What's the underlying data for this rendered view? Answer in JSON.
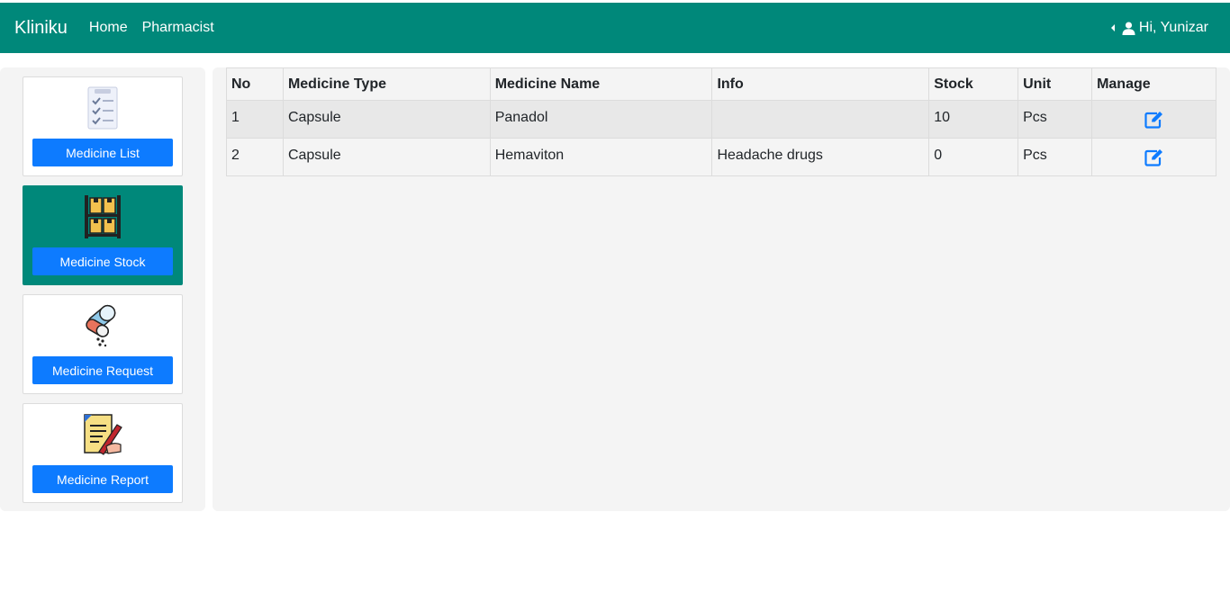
{
  "navbar": {
    "brand": "Kliniku",
    "links": [
      "Home",
      "Pharmacist"
    ],
    "user_greeting": "Hi, Yunizar"
  },
  "sidebar": {
    "cards": [
      {
        "label": "Medicine List",
        "icon": "checklist-icon",
        "active": false
      },
      {
        "label": "Medicine Stock",
        "icon": "shelf-boxes-icon",
        "active": true
      },
      {
        "label": "Medicine Request",
        "icon": "pills-icon",
        "active": false
      },
      {
        "label": "Medicine Report",
        "icon": "report-pen-icon",
        "active": false
      }
    ]
  },
  "table": {
    "headers": [
      "No",
      "Medicine Type",
      "Medicine Name",
      "Info",
      "Stock",
      "Unit",
      "Manage"
    ],
    "rows": [
      {
        "no": "1",
        "type": "Capsule",
        "name": "Panadol",
        "info": "",
        "stock": "10",
        "unit": "Pcs"
      },
      {
        "no": "2",
        "type": "Capsule",
        "name": "Hemaviton",
        "info": "Headache drugs",
        "stock": "0",
        "unit": "Pcs"
      }
    ]
  },
  "colors": {
    "navbar": "#00887a",
    "button": "#0d7bff",
    "edit_icon": "#0d7bff"
  }
}
